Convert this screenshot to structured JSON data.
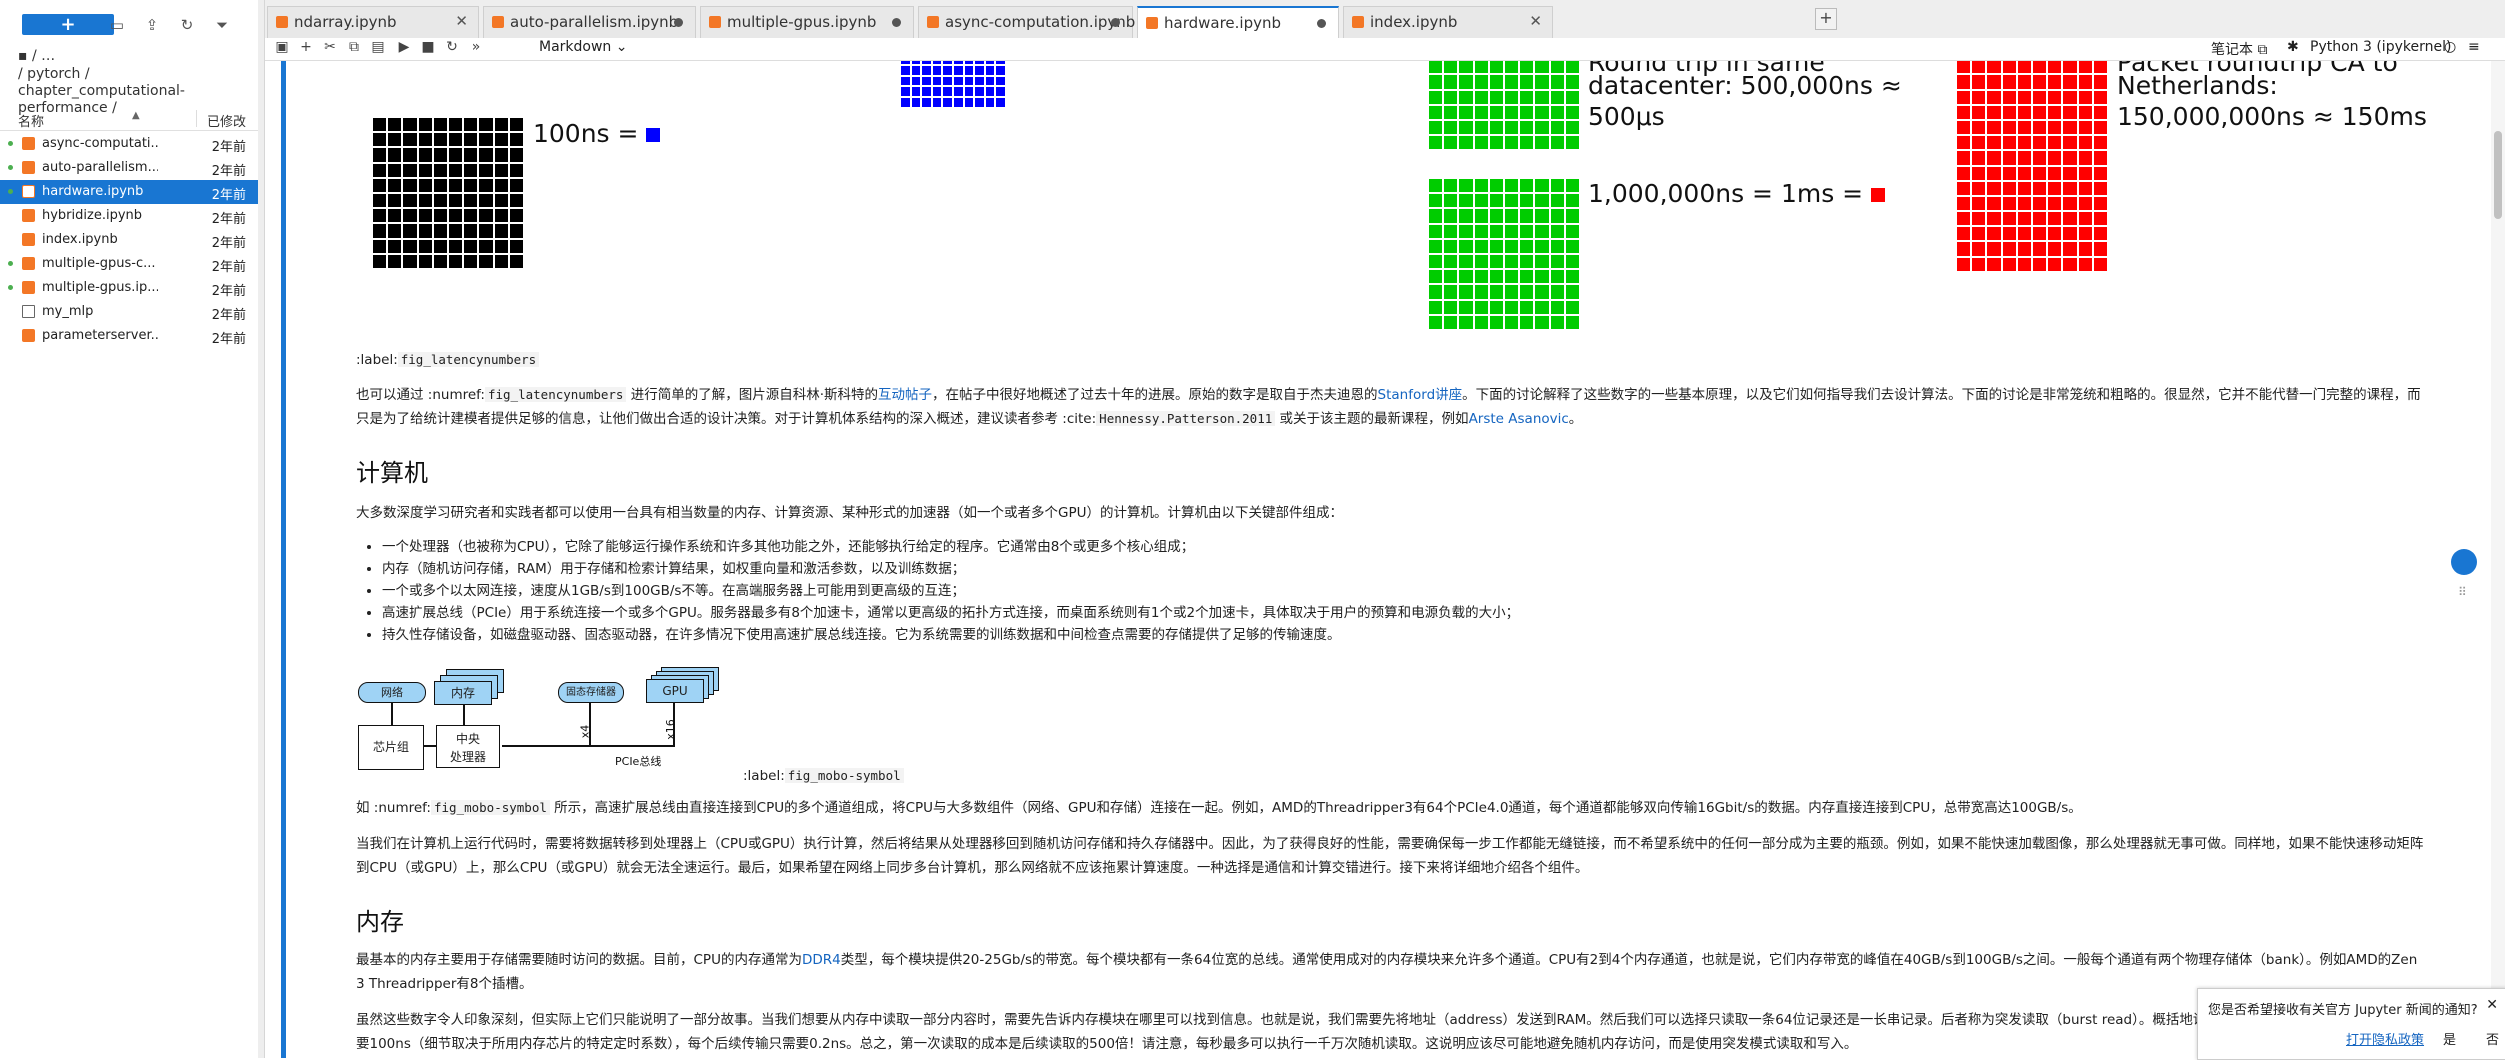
{
  "sidebar": {
    "new_button": "+",
    "breadcrumb_top": "/ …",
    "breadcrumb_path": "/ pytorch / chapter_computational-performance /",
    "col_name": "名称",
    "col_modified": "已修改",
    "files": [
      {
        "name": "async-computati...",
        "modified": "2年前",
        "type": "notebook",
        "running": true
      },
      {
        "name": "auto-parallelism....",
        "modified": "2年前",
        "type": "notebook",
        "running": true
      },
      {
        "name": "hardware.ipynb",
        "modified": "2年前",
        "type": "notebook",
        "running": true,
        "selected": true
      },
      {
        "name": "hybridize.ipynb",
        "modified": "2年前",
        "type": "notebook"
      },
      {
        "name": "index.ipynb",
        "modified": "2年前",
        "type": "notebook"
      },
      {
        "name": "multiple-gpus-c...",
        "modified": "2年前",
        "type": "notebook",
        "running": true
      },
      {
        "name": "multiple-gpus.ip...",
        "modified": "2年前",
        "type": "notebook",
        "running": true
      },
      {
        "name": "my_mlp",
        "modified": "2年前",
        "type": "file"
      },
      {
        "name": "parameterserver....",
        "modified": "2年前",
        "type": "notebook"
      }
    ]
  },
  "tabs": [
    {
      "label": "ndarray.ipynb",
      "state": "close"
    },
    {
      "label": "auto-parallelism.ipynb",
      "state": "dirty"
    },
    {
      "label": "multiple-gpus.ipynb",
      "state": "dirty"
    },
    {
      "label": "async-computation.ipynb",
      "state": "dirty"
    },
    {
      "label": "hardware.ipynb",
      "state": "dirty",
      "active": true
    },
    {
      "label": "index.ipynb",
      "state": "close"
    }
  ],
  "toolbar": {
    "cell_type": "Markdown",
    "notebook_label": "笔记本",
    "kernel": "Python 3 (ipykernel)"
  },
  "figure_latency": {
    "t_datacenter": "datacenter: 500,000ns ≈",
    "t_datacenter2": "500μs",
    "t_roundtrip_cut": "Round trip in same",
    "t_100ns": "100ns =",
    "t_1ms": "1,000,000ns = 1ms =",
    "t_packet_cut": "Packet roundtrip CA to",
    "t_netherlands": "Netherlands:",
    "t_150ms": "150,000,000ns ≈ 150ms",
    "colors": {
      "black": "#000000",
      "blue": "#0000ff",
      "green": "#00cc00",
      "red": "#ff0000"
    }
  },
  "content": {
    "label1_prefix": ":label:",
    "label1_code": "fig_latencynumbers",
    "para1_a": "也可以通过 :numref:",
    "para1_code": "fig_latencynumbers",
    "para1_b": " 进行简单的了解，图片源自科林·斯科特的",
    "para1_link1": "互动帖子",
    "para1_c": "，在帖子中很好地概述了过去十年的进展。原始的数字是取自于杰夫迪恩的",
    "para1_link2": "Stanford讲座",
    "para1_d": "。下面的讨论解释了这些数字的一些基本原理，以及它们如何指导我们去设计算法。下面的讨论是非常笼统和粗略的。很显然，它并不能代替一门完整的课程，而只是为了给统计建模者提供足够的信息，让他们做出合适的设计决策。对于计算机体系结构的深入概述，建议读者参考 :cite:",
    "para1_code2": "Hennessy.Patterson.2011",
    "para1_e": " 或关于该主题的最新课程，例如",
    "para1_link3": "Arste Asanovic",
    "para1_f": "。",
    "h_computer": "计算机",
    "para2": "大多数深度学习研究者和实践者都可以使用一台具有相当数量的内存、计算资源、某种形式的加速器（如一个或者多个GPU）的计算机。计算机由以下关键部件组成：",
    "bullets": [
      "一个处理器（也被称为CPU），它除了能够运行操作系统和许多其他功能之外，还能够执行给定的程序。它通常由8个或更多个核心组成；",
      "内存（随机访问存储，RAM）用于存储和检索计算结果，如权重向量和激活参数，以及训练数据；",
      "一个或多个以太网连接，速度从1GB/s到100GB/s不等。在高端服务器上可能用到更高级的互连；",
      "高速扩展总线（PCIe）用于系统连接一个或多个GPU。服务器最多有8个加速卡，通常以更高级的拓扑方式连接，而桌面系统则有1个或2个加速卡，具体取决于用户的预算和电源负载的大小；",
      "持久性存储设备，如磁盘驱动器、固态驱动器，在许多情况下使用高速扩展总线连接。它为系统需要的训练数据和中间检查点需要的存储提供了足够的传输速度。"
    ],
    "label2_prefix": ":label:",
    "label2_code": "fig_mobo-symbol",
    "para3_a": "如 :numref:",
    "para3_code": "fig_mobo-symbol",
    "para3_b": " 所示，高速扩展总线由直接连接到CPU的多个通道组成，将CPU与大多数组件（网络、GPU和存储）连接在一起。例如，AMD的Threadripper3有64个PCIe4.0通道，每个通道都能够双向传输16Gbit/s的数据。内存直接连接到CPU，总带宽高达100GB/s。",
    "para4": "当我们在计算机上运行代码时，需要将数据转移到处理器上（CPU或GPU）执行计算，然后将结果从处理器移回到随机访问存储和持久存储器中。因此，为了获得良好的性能，需要确保每一步工作都能无缝链接，而不希望系统中的任何一部分成为主要的瓶颈。例如，如果不能快速加载图像，那么处理器就无事可做。同样地，如果不能快速移动矩阵到CPU（或GPU）上，那么CPU（或GPU）就会无法全速运行。最后，如果希望在网络上同步多台计算机，那么网络就不应该拖累计算速度。一种选择是通信和计算交错进行。接下来将详细地介绍各个组件。",
    "h_memory": "内存",
    "para5_a": "最基本的内存主要用于存储需要随时访问的数据。目前，CPU的内存通常为",
    "para5_link": "DDR4",
    "para5_b": "类型，每个模块提供20-25Gb/s的带宽。每个模块都有一条64位宽的总线。通常使用成对的内存模块来允许多个通道。CPU有2到4个内存通道，也就是说，它们内存带宽的峰值在40GB/s到100GB/s之间。一般每个通道有两个物理存储体（bank）。例如AMD的Zen 3 Threadripper有8个插槽。",
    "para6": "虽然这些数字令人印象深刻，但实际上它们只能说明了一部分故事。当我们想要从内存中读取一部分内容时，需要先告诉内存模块在哪里可以找到信息。也就是说，我们需要先将地址（address）发送到RAM。然后我们可以选择只读取一条64位记录还是一长串记录。后者称为突发读取（burst read）。概括地说，向内存发送地址并设置传输大约需要100ns（细节取决于所用内存芯片的特定定时系数），每个后续传输只需要0.2ns。总之，第一次读取的成本是后续读取的500倍！请注意，每秒最多可以执行一千万次随机读取。这说明应该尽可能地避免随机内存访问，而是使用突发模式读取和写入。"
  },
  "diagram": {
    "network": "网络",
    "memory": "内存",
    "ssd": "固态存储器",
    "gpu": "GPU",
    "chipset": "芯片组",
    "cpu_line1": "中央",
    "cpu_line2": "处理器",
    "x4": "x4",
    "x16": "x16",
    "pcie": "PCIe总线"
  },
  "notification": {
    "text": "您是否希望接收有关官方 Jupyter 新闻的通知?",
    "link": "打开隐私政策",
    "yes": "是",
    "no": "否"
  }
}
